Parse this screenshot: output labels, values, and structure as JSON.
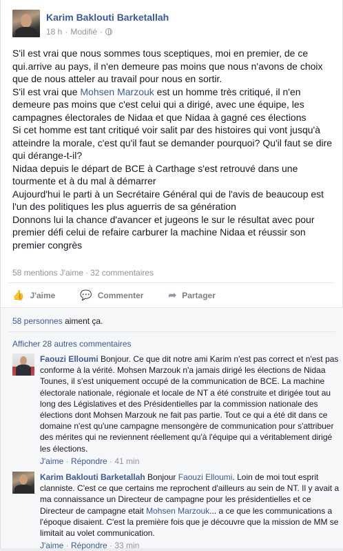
{
  "post": {
    "author": "Karim Baklouti Barketallah",
    "time": "18 h",
    "edited": "Modifié",
    "paragraphs": [
      "S'il est vrai que nous sommes tous sceptiques, moi en premier, de ce qui.arrive au pays, il n'en demeure pas moins que nous n'avons de choix que de nous atteler au travail pour nous en sortir.",
      "S'il est vrai que Mohsen Marzouk est un homme très critiqué, il n'en demeure pas moins que c'est celui qui a dirigé, avec une équipe, les campagnes électorales de Nidaa et que Nidaa à gagné ces élections",
      "Si cet homme est tant critiqué voir salit par des histoires qui vont jusqu'à atteindre la morale, c'est qu'il faut se demander pourquoi? Qu'il faut se dire qui dérange-t-il?",
      "Nidaa depuis le départ de BCE à Carthage s'est retrouvé dans une tourmente et à du mal à démarrer",
      "Aujourd'hui le parti à un Secrétaire Général qui de l'avis de beaucoup est l'un des politiques les plus aguerris de sa génération",
      "Donnons lui la chance d'avancer et jugeons le sur le résultat avec pour premier défi celui de refaire carburer la machine Nidaa et réussir son premier congrès"
    ],
    "p2_before": "S'il est vrai que ",
    "p2_link": "Mohsen Marzouk",
    "p2_after": " est un homme très critiqué, il n'en demeure pas moins que c'est celui qui a dirigé, avec une équipe, les campagnes électorales de Nidaa et que Nidaa à gagné ces élections"
  },
  "stats": {
    "likes": "58 mentions J'aime",
    "comments": "32 commentaires"
  },
  "actions": {
    "like": "J'aime",
    "comment": "Commenter",
    "share": "Partager"
  },
  "feedback": {
    "likes_link": "58 personnes",
    "likes_text": " aiment ça.",
    "more_comments": "Afficher 28 autres commentaires"
  },
  "comments": [
    {
      "author": "Faouzi Elloumi",
      "text": " Bonjour. Ce que dit notre ami Karim n'est pas correct et n'est pas conforme à la vérité. Mohsen Marzouk n'a jamais dirigé les élections de Nidaa Tounes, il s'est uniquement occupé de la communication de BCE. La machine électorale nationale, régionale et locale de NT a été construite et dirigée tout au long des Législatives et des Présidentielles par la commission nationale des élections dont Mohsen Marzouk ne fait pas partie. Tout ce qui a été dit dans ce domaine n'est qu'une campagne mensongère de communication pour s'attribuer des mérites qui ne reviennent réellement qu'à l'équipe qui a véritablement dirigé les élections.",
      "like": "J'aime",
      "reply": "Répondre",
      "time": "41 min"
    },
    {
      "author": "Karim Baklouti Barketallah",
      "text_a": " Bonjour ",
      "mention1": "Faouzi Elloumi",
      "text_b": ". Loin de moi tout esprit clanniste. C'est ce que certains me reprochent d'ailleurs au sein de NT. Il y avait a ma connaissance un Directeur de campagne pour les présidentielles et ce Directeur de campagne etait ",
      "mention2": "Mohsen Marzouk",
      "text_c": "... a ce que les communications a l'époque disaient. C'est la première fois que je découvre que la mission de MM se limitait au volet communication.",
      "like": "J'aime",
      "reply": "Répondre",
      "time": "33 min"
    }
  ],
  "meta_sep": " · "
}
